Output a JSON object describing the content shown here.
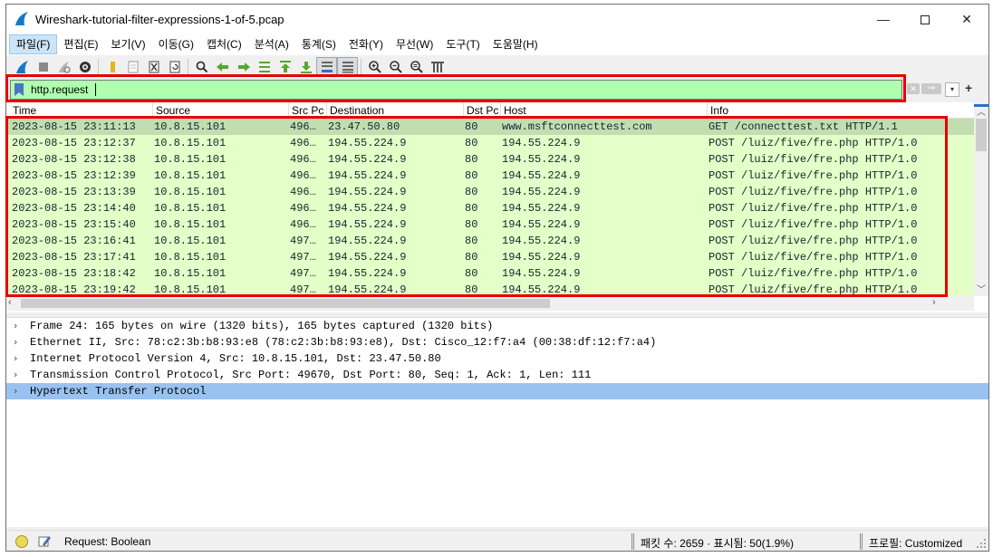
{
  "window": {
    "title": "Wireshark-tutorial-filter-expressions-1-of-5.pcap",
    "minimize": "—",
    "close": "✕"
  },
  "menu": [
    "파일(F)",
    "편집(E)",
    "보기(V)",
    "이동(G)",
    "캡처(C)",
    "분석(A)",
    "통계(S)",
    "전화(Y)",
    "무선(W)",
    "도구(T)",
    "도움말(H)"
  ],
  "toolbar": [
    {
      "name": "start-capture-icon"
    },
    {
      "name": "stop-capture-icon"
    },
    {
      "name": "restart-capture-icon"
    },
    {
      "name": "capture-options-icon"
    },
    {
      "sep": true
    },
    {
      "name": "open-file-icon"
    },
    {
      "name": "save-file-icon"
    },
    {
      "name": "close-file-icon"
    },
    {
      "name": "reload-file-icon"
    },
    {
      "sep": true
    },
    {
      "name": "find-packet-icon"
    },
    {
      "name": "go-back-icon"
    },
    {
      "name": "go-forward-icon"
    },
    {
      "name": "go-to-packet-icon"
    },
    {
      "name": "go-first-packet-icon"
    },
    {
      "name": "go-last-packet-icon"
    },
    {
      "name": "auto-scroll-icon",
      "pressed": true
    },
    {
      "name": "colorize-icon",
      "pressed": true
    },
    {
      "sep": true
    },
    {
      "name": "zoom-in-icon"
    },
    {
      "name": "zoom-out-icon"
    },
    {
      "name": "zoom-normal-icon"
    },
    {
      "name": "resize-columns-icon"
    }
  ],
  "filter": {
    "value": "http.request",
    "clear": "✕",
    "apply": "⇒",
    "dropdown": "▾",
    "add": "+"
  },
  "packet_list": {
    "columns": [
      "Time",
      "Source",
      "Src Pc",
      "Destination",
      "Dst Pc",
      "Host",
      "Info"
    ],
    "rows": [
      {
        "time": "2023-08-15 23:11:13",
        "src": "10.8.15.101",
        "sport": "496…",
        "dst": "23.47.50.80",
        "dport": "80",
        "host": "www.msftconnecttest.com",
        "info": "GET /connecttest.txt HTTP/1.1",
        "selected": true
      },
      {
        "time": "2023-08-15 23:12:37",
        "src": "10.8.15.101",
        "sport": "496…",
        "dst": "194.55.224.9",
        "dport": "80",
        "host": "194.55.224.9",
        "info": "POST /luiz/five/fre.php HTTP/1.0"
      },
      {
        "time": "2023-08-15 23:12:38",
        "src": "10.8.15.101",
        "sport": "496…",
        "dst": "194.55.224.9",
        "dport": "80",
        "host": "194.55.224.9",
        "info": "POST /luiz/five/fre.php HTTP/1.0"
      },
      {
        "time": "2023-08-15 23:12:39",
        "src": "10.8.15.101",
        "sport": "496…",
        "dst": "194.55.224.9",
        "dport": "80",
        "host": "194.55.224.9",
        "info": "POST /luiz/five/fre.php HTTP/1.0"
      },
      {
        "time": "2023-08-15 23:13:39",
        "src": "10.8.15.101",
        "sport": "496…",
        "dst": "194.55.224.9",
        "dport": "80",
        "host": "194.55.224.9",
        "info": "POST /luiz/five/fre.php HTTP/1.0"
      },
      {
        "time": "2023-08-15 23:14:40",
        "src": "10.8.15.101",
        "sport": "496…",
        "dst": "194.55.224.9",
        "dport": "80",
        "host": "194.55.224.9",
        "info": "POST /luiz/five/fre.php HTTP/1.0"
      },
      {
        "time": "2023-08-15 23:15:40",
        "src": "10.8.15.101",
        "sport": "496…",
        "dst": "194.55.224.9",
        "dport": "80",
        "host": "194.55.224.9",
        "info": "POST /luiz/five/fre.php HTTP/1.0"
      },
      {
        "time": "2023-08-15 23:16:41",
        "src": "10.8.15.101",
        "sport": "497…",
        "dst": "194.55.224.9",
        "dport": "80",
        "host": "194.55.224.9",
        "info": "POST /luiz/five/fre.php HTTP/1.0"
      },
      {
        "time": "2023-08-15 23:17:41",
        "src": "10.8.15.101",
        "sport": "497…",
        "dst": "194.55.224.9",
        "dport": "80",
        "host": "194.55.224.9",
        "info": "POST /luiz/five/fre.php HTTP/1.0"
      },
      {
        "time": "2023-08-15 23:18:42",
        "src": "10.8.15.101",
        "sport": "497…",
        "dst": "194.55.224.9",
        "dport": "80",
        "host": "194.55.224.9",
        "info": "POST /luiz/five/fre.php HTTP/1.0"
      },
      {
        "time": "2023-08-15 23:19:42",
        "src": "10.8.15.101",
        "sport": "497…",
        "dst": "194.55.224.9",
        "dport": "80",
        "host": "194.55.224.9",
        "info": "POST /luiz/five/fre.php HTTP/1.0"
      }
    ]
  },
  "packet_details": [
    {
      "text": "Frame 24: 165 bytes on wire (1320 bits), 165 bytes captured (1320 bits)"
    },
    {
      "text": "Ethernet II, Src: 78:c2:3b:b8:93:e8 (78:c2:3b:b8:93:e8), Dst: Cisco_12:f7:a4 (00:38:df:12:f7:a4)"
    },
    {
      "text": "Internet Protocol Version 4, Src: 10.8.15.101, Dst: 23.47.50.80"
    },
    {
      "text": "Transmission Control Protocol, Src Port: 49670, Dst Port: 80, Seq: 1, Ack: 1, Len: 111"
    },
    {
      "text": "Hypertext Transfer Protocol",
      "selected": true
    }
  ],
  "status": {
    "field_info": "Request: Boolean",
    "packets": "패킷 수: 2659 · 표시됨: 50(1.9%)",
    "profile": "프로필: Customized"
  },
  "colors": {
    "filter_valid": "#afffaf",
    "http_row": "#e4ffc7",
    "annotation": "#e40000",
    "detail_selected": "#99c2f0"
  }
}
